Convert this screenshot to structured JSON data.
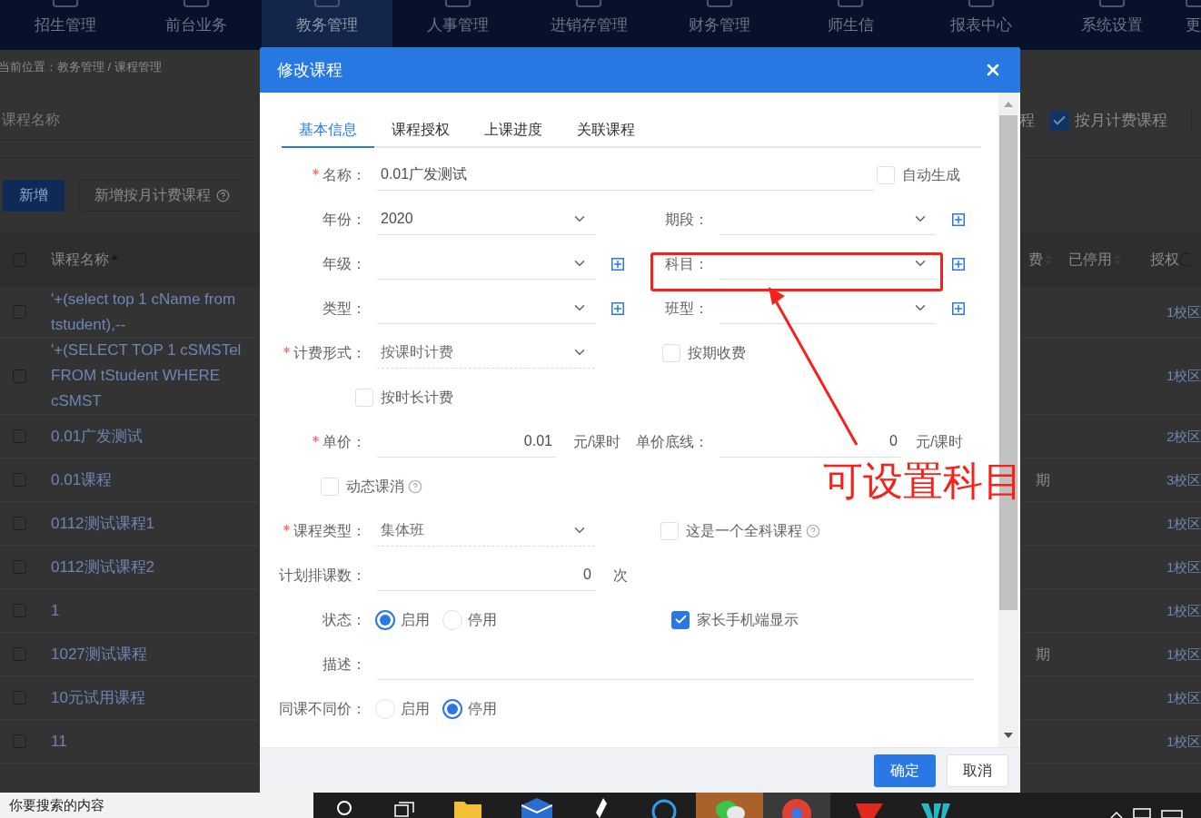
{
  "top_nav": [
    {
      "label": "招生管理",
      "selected": false
    },
    {
      "label": "前台业务",
      "selected": false
    },
    {
      "label": "教务管理",
      "selected": true
    },
    {
      "label": "人事管理",
      "selected": false
    },
    {
      "label": "进销存管理",
      "selected": false
    },
    {
      "label": "财务管理",
      "selected": false
    },
    {
      "label": "师生信",
      "selected": false
    },
    {
      "label": "报表中心",
      "selected": false
    },
    {
      "label": "系统设置",
      "selected": false
    },
    {
      "label": "更",
      "selected": false
    }
  ],
  "breadcrumb": "当前位置：教务管理 / 课程管理",
  "search": {
    "placeholder": "课程名称"
  },
  "monthly_filter": {
    "prefix": "程",
    "label": "按月计费课程",
    "checked": true
  },
  "toolbar": {
    "add": "新增",
    "add_monthly": "新增按月计费课程"
  },
  "table": {
    "select_all": false,
    "columns": {
      "name": "课程名称",
      "fee": "费",
      "stopped": "已停用",
      "auth": "授权"
    },
    "rows": [
      {
        "checked": false,
        "name": "'+(select top 1 cName from tstudent),--",
        "auth": "1校区"
      },
      {
        "checked": false,
        "name": "'+(SELECT TOP 1 cSMSTel FROM tStudent WHERE cSMST",
        "auth": "1校区"
      },
      {
        "checked": false,
        "name": "0.01广发测试",
        "auth": "2校区"
      },
      {
        "checked": false,
        "name": "0.01课程",
        "fee": "期",
        "auth": "3校区"
      },
      {
        "checked": false,
        "name": "0112测试课程1",
        "auth": "1校区"
      },
      {
        "checked": false,
        "name": "0112测试课程2",
        "auth": "1校区"
      },
      {
        "checked": false,
        "name": "1",
        "auth": "1校区"
      },
      {
        "checked": false,
        "name": "1027测试课程",
        "fee": "期",
        "auth": "1校区"
      },
      {
        "checked": false,
        "name": "10元试用课程",
        "auth": "1校区"
      },
      {
        "checked": false,
        "name": "11",
        "auth": "1校区"
      }
    ]
  },
  "dialog": {
    "title": "修改课程",
    "tabs": [
      {
        "label": "基本信息",
        "selected": true
      },
      {
        "label": "课程授权",
        "selected": false
      },
      {
        "label": "上课进度",
        "selected": false
      },
      {
        "label": "关联课程",
        "selected": false
      }
    ],
    "form": {
      "name": {
        "label": "名称：",
        "required": true,
        "value": "0.01广发测试"
      },
      "auto_generate": {
        "label": "自动生成",
        "checked": false
      },
      "year": {
        "label": "年份：",
        "value": "2020"
      },
      "period": {
        "label": "期段：",
        "has_add": true
      },
      "grade": {
        "label": "年级：",
        "has_add": true
      },
      "subject": {
        "label": "科目：",
        "has_add": true,
        "highlighted": true
      },
      "type": {
        "label": "类型：",
        "has_add": true
      },
      "class_type": {
        "label": "班型：",
        "has_add": true
      },
      "billing": {
        "label": "计费形式：",
        "required": true,
        "value": "按课时计费",
        "disabled": true
      },
      "by_term": {
        "label": "按期收费",
        "checked": false
      },
      "by_duration": {
        "label": "按时长计费",
        "checked": false
      },
      "price": {
        "label": "单价：",
        "required": true,
        "value": "0.01",
        "unit": "元/课时"
      },
      "price_floor": {
        "label": "单价底线：",
        "value": "0",
        "unit": "元/课时"
      },
      "dynamic": {
        "label": "动态课消",
        "checked": false
      },
      "course_type": {
        "label": "课程类型：",
        "required": true,
        "value": "集体班",
        "disabled": true
      },
      "all_subject": {
        "label": "这是一个全科课程",
        "checked": false
      },
      "planned": {
        "label": "计划排课数：",
        "value": "0",
        "unit": "次"
      },
      "status": {
        "label": "状态：",
        "options": [
          {
            "label": "启用",
            "selected": true
          },
          {
            "label": "停用",
            "selected": false
          }
        ]
      },
      "parent_display": {
        "label": "家长手机端显示",
        "checked": true
      },
      "description": {
        "label": "描述："
      },
      "diff_price": {
        "label": "同课不同价：",
        "options": [
          {
            "label": "启用",
            "selected": false
          },
          {
            "label": "停用",
            "selected": true
          }
        ]
      }
    },
    "buttons": {
      "ok": "确定",
      "cancel": "取消"
    }
  },
  "annotation": {
    "text": "可设置科目"
  },
  "taskbar": {
    "search_placeholder": "你要搜索的内容"
  }
}
